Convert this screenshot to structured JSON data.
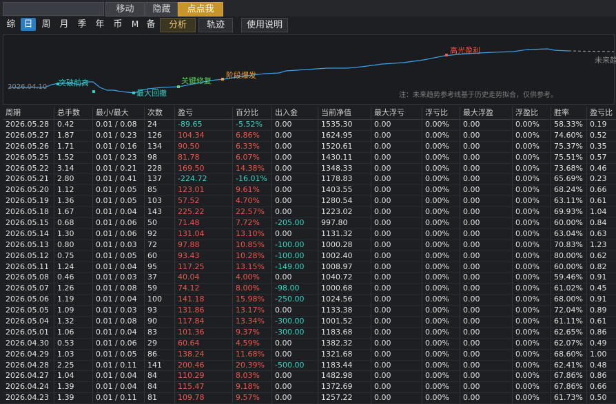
{
  "toolbar": {
    "title_value": "",
    "move_label": "移动",
    "hide_label": "隐藏",
    "click_me_label": "点点我"
  },
  "tabs": {
    "summary": "综",
    "day": "日",
    "week": "周",
    "month": "月",
    "season": "季",
    "year": "年",
    "coin": "币",
    "m": "M",
    "backup": "备",
    "analysis": "分析",
    "track": "轨迹",
    "help": "使用说明"
  },
  "chart": {
    "start_date": "2026.04.10",
    "labels": {
      "breakthrough": "突破前高",
      "max_drawdown": "最大回撤",
      "key_repair": "关键修复",
      "phase_burst": "阶段爆发",
      "peak_profit": "高光盈利",
      "future": "未来趋"
    },
    "note": "注：未来趋势参考线基于历史走势拟合，仅供参考。",
    "colors": {
      "line": "#3aa3e8",
      "breakthrough": "#2fd0c4",
      "max_drawdown": "#2fd0c4",
      "key_repair": "#5ad35a",
      "phase_burst": "#f0a33a",
      "peak_profit": "#f05a4a"
    }
  },
  "table": {
    "headers": [
      "周期",
      "总手数",
      "最小/最大",
      "次数",
      "盈亏",
      "百分比",
      "出入金",
      "当前净值",
      "最大浮亏",
      "浮亏比",
      "最大浮盈",
      "浮盈比",
      "胜率",
      "盈亏比"
    ],
    "rows": [
      [
        "2026.05.28",
        "0.42",
        "0.01 / 0.08",
        "24",
        "-89.65",
        "-5.52%",
        "0.00",
        "1535.30",
        "0.00",
        "0.00%",
        "0.00",
        "0.00%",
        "58.33%",
        "0.19"
      ],
      [
        "2026.05.27",
        "1.87",
        "0.01 / 0.23",
        "126",
        "104.34",
        "6.86%",
        "0.00",
        "1624.95",
        "0.00",
        "0.00%",
        "0.00",
        "0.00%",
        "74.60%",
        "0.52"
      ],
      [
        "2026.05.26",
        "1.71",
        "0.01 / 0.16",
        "134",
        "90.50",
        "6.33%",
        "0.00",
        "1520.61",
        "0.00",
        "0.00%",
        "0.00",
        "0.00%",
        "75.37%",
        "0.35"
      ],
      [
        "2026.05.25",
        "1.52",
        "0.01 / 0.23",
        "98",
        "81.78",
        "6.07%",
        "0.00",
        "1430.11",
        "0.00",
        "0.00%",
        "0.00",
        "0.00%",
        "75.51%",
        "0.57"
      ],
      [
        "2026.05.22",
        "3.14",
        "0.01 / 0.21",
        "228",
        "169.50",
        "14.38%",
        "0.00",
        "1348.33",
        "0.00",
        "0.00%",
        "0.00",
        "0.00%",
        "73.68%",
        "0.46"
      ],
      [
        "2026.05.21",
        "2.80",
        "0.01 / 0.41",
        "137",
        "-224.72",
        "-16.01%",
        "0.00",
        "1178.83",
        "0.00",
        "0.00%",
        "0.00",
        "0.00%",
        "65.69%",
        "0.23"
      ],
      [
        "2026.05.20",
        "1.12",
        "0.01 / 0.05",
        "85",
        "123.01",
        "9.61%",
        "0.00",
        "1403.55",
        "0.00",
        "0.00%",
        "0.00",
        "0.00%",
        "68.24%",
        "0.66"
      ],
      [
        "2026.05.19",
        "1.36",
        "0.01 / 0.05",
        "103",
        "57.52",
        "4.70%",
        "0.00",
        "1280.54",
        "0.00",
        "0.00%",
        "0.00",
        "0.00%",
        "63.11%",
        "0.61"
      ],
      [
        "2026.05.18",
        "1.67",
        "0.01 / 0.04",
        "143",
        "225.22",
        "22.57%",
        "0.00",
        "1223.02",
        "0.00",
        "0.00%",
        "0.00",
        "0.00%",
        "69.93%",
        "1.04"
      ],
      [
        "2026.05.15",
        "0.68",
        "0.01 / 0.06",
        "50",
        "71.48",
        "7.72%",
        "-205.00",
        "997.80",
        "0.00",
        "0.00%",
        "0.00",
        "0.00%",
        "60.00%",
        "0.84"
      ],
      [
        "2026.05.14",
        "1.30",
        "0.01 / 0.06",
        "92",
        "131.04",
        "13.10%",
        "0.00",
        "1131.32",
        "0.00",
        "0.00%",
        "0.00",
        "0.00%",
        "63.04%",
        "0.63"
      ],
      [
        "2026.05.13",
        "0.80",
        "0.01 / 0.03",
        "72",
        "97.88",
        "10.85%",
        "-100.00",
        "1000.28",
        "0.00",
        "0.00%",
        "0.00",
        "0.00%",
        "70.83%",
        "1.23"
      ],
      [
        "2026.05.12",
        "0.75",
        "0.01 / 0.05",
        "60",
        "93.43",
        "10.28%",
        "-100.00",
        "1002.40",
        "0.00",
        "0.00%",
        "0.00",
        "0.00%",
        "80.00%",
        "0.62"
      ],
      [
        "2026.05.11",
        "1.24",
        "0.01 / 0.04",
        "95",
        "117.25",
        "13.15%",
        "-149.00",
        "1008.97",
        "0.00",
        "0.00%",
        "0.00",
        "0.00%",
        "60.00%",
        "0.82"
      ],
      [
        "2026.05.08",
        "0.46",
        "0.01 / 0.03",
        "37",
        "40.04",
        "4.00%",
        "0.00",
        "1040.72",
        "0.00",
        "0.00%",
        "0.00",
        "0.00%",
        "59.46%",
        "0.91"
      ],
      [
        "2026.05.07",
        "1.26",
        "0.01 / 0.08",
        "59",
        "74.12",
        "8.00%",
        "-98.00",
        "1000.68",
        "0.00",
        "0.00%",
        "0.00",
        "0.00%",
        "61.02%",
        "0.45"
      ],
      [
        "2026.05.06",
        "1.19",
        "0.01 / 0.04",
        "100",
        "141.18",
        "15.98%",
        "-250.00",
        "1024.56",
        "0.00",
        "0.00%",
        "0.00",
        "0.00%",
        "68.00%",
        "0.91"
      ],
      [
        "2026.05.05",
        "1.09",
        "0.01 / 0.03",
        "93",
        "131.86",
        "13.17%",
        "0.00",
        "1133.38",
        "0.00",
        "0.00%",
        "0.00",
        "0.00%",
        "72.04%",
        "0.89"
      ],
      [
        "2026.05.04",
        "1.32",
        "0.01 / 0.08",
        "90",
        "117.84",
        "13.34%",
        "-300.00",
        "1001.52",
        "0.00",
        "0.00%",
        "0.00",
        "0.00%",
        "61.11%",
        "0.61"
      ],
      [
        "2026.05.01",
        "1.06",
        "0.01 / 0.04",
        "83",
        "101.36",
        "9.37%",
        "-300.00",
        "1183.68",
        "0.00",
        "0.00%",
        "0.00",
        "0.00%",
        "62.65%",
        "0.86"
      ],
      [
        "2026.04.30",
        "0.53",
        "0.01 / 0.06",
        "29",
        "60.64",
        "4.59%",
        "0.00",
        "1382.32",
        "0.00",
        "0.00%",
        "0.00",
        "0.00%",
        "62.07%",
        "0.49"
      ],
      [
        "2026.04.29",
        "1.03",
        "0.01 / 0.05",
        "86",
        "138.24",
        "11.68%",
        "0.00",
        "1321.68",
        "0.00",
        "0.00%",
        "0.00",
        "0.00%",
        "68.60%",
        "1.00"
      ],
      [
        "2026.04.28",
        "2.25",
        "0.01 / 0.11",
        "141",
        "200.46",
        "20.39%",
        "-500.00",
        "1183.44",
        "0.00",
        "0.00%",
        "0.00",
        "0.00%",
        "62.41%",
        "0.48"
      ],
      [
        "2026.04.27",
        "1.04",
        "0.01 / 0.04",
        "84",
        "110.29",
        "8.03%",
        "0.00",
        "1482.98",
        "0.00",
        "0.00%",
        "0.00",
        "0.00%",
        "67.86%",
        "0.86"
      ],
      [
        "2026.04.24",
        "1.39",
        "0.01 / 0.04",
        "84",
        "115.47",
        "9.18%",
        "0.00",
        "1372.69",
        "0.00",
        "0.00%",
        "0.00",
        "0.00%",
        "67.86%",
        "0.66"
      ],
      [
        "2026.04.23",
        "1.39",
        "0.01 / 0.11",
        "81",
        "109.78",
        "9.57%",
        "0.00",
        "1257.22",
        "0.00",
        "0.00%",
        "0.00",
        "0.00%",
        "61.73%",
        "0.50"
      ]
    ]
  }
}
